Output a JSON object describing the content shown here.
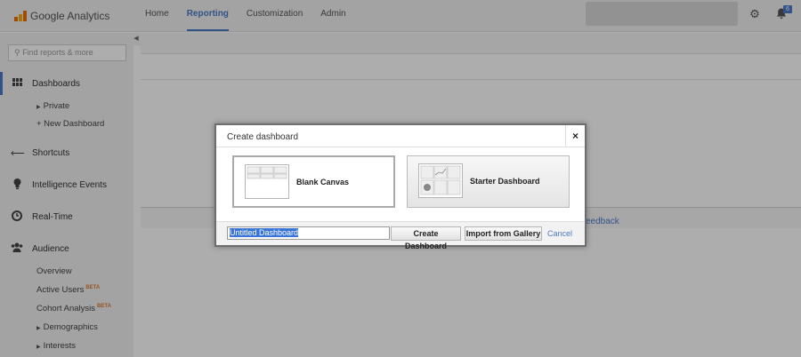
{
  "app": {
    "logo_text": "Google Analytics",
    "accent_color": "#4a7bc8"
  },
  "nav": {
    "items": [
      {
        "label": "Home"
      },
      {
        "label": "Reporting"
      },
      {
        "label": "Customization"
      },
      {
        "label": "Admin"
      }
    ],
    "active": "Reporting"
  },
  "header": {
    "gear_icon": "gear-icon",
    "bell_icon": "bell-icon",
    "notification_count": "6"
  },
  "sidebar": {
    "search_placeholder": "Find reports & more",
    "sections": {
      "dashboards": "Dashboards",
      "shortcuts": "Shortcuts",
      "intelligence": "Intelligence Events",
      "realtime": "Real-Time",
      "audience": "Audience"
    },
    "dashboard_items": {
      "private": "Private",
      "new_dashboard": "+ New Dashboard"
    },
    "audience_items": {
      "overview": "Overview",
      "active_users": "Active Users",
      "cohort": "Cohort Analysis",
      "demographics": "Demographics",
      "interests": "Interests"
    },
    "beta_label": "BETA"
  },
  "main": {
    "feedback_fragment": "eedback"
  },
  "dialog": {
    "title": "Create dashboard",
    "close_label": "×",
    "options": {
      "blank": "Blank Canvas",
      "starter": "Starter Dashboard"
    },
    "name_value": "Untitled Dashboard",
    "buttons": {
      "create": "Create Dashboard",
      "gallery": "Import from Gallery",
      "cancel": "Cancel"
    }
  }
}
